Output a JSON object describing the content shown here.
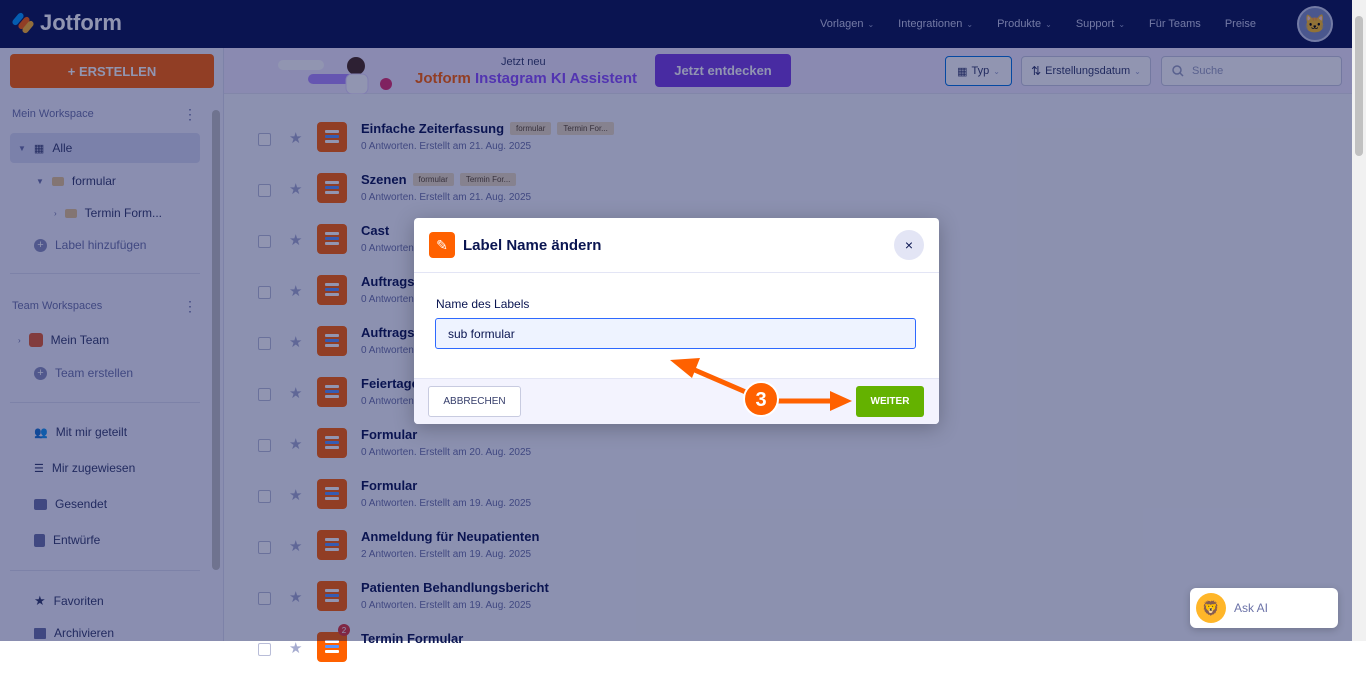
{
  "brand": {
    "name": "Jotform"
  },
  "nav": {
    "items": [
      {
        "label": "Vorlagen",
        "caret": true
      },
      {
        "label": "Integrationen",
        "caret": true
      },
      {
        "label": "Produkte",
        "caret": true
      },
      {
        "label": "Support",
        "caret": true
      },
      {
        "label": "Für Teams",
        "caret": false
      },
      {
        "label": "Preise",
        "caret": false
      }
    ]
  },
  "sidebar": {
    "create_label": "+ ERSTELLEN",
    "my_workspace": "Mein Workspace",
    "all_label": "Alle",
    "folder1": "formular",
    "folder2": "Termin Form...",
    "add_label": "Label hinzufügen",
    "team_workspaces": "Team Workspaces",
    "my_team": "Mein Team",
    "create_team": "Team erstellen",
    "shared": "Mit mir geteilt",
    "assigned": "Mir zugewiesen",
    "sent": "Gesendet",
    "drafts": "Entwürfe",
    "favorites": "Favoriten",
    "archive": "Archivieren"
  },
  "banner": {
    "new_label": "Jetzt neu",
    "title_a": "Jotform",
    "title_b": "Instagram KI Assistent",
    "cta": "Jetzt entdecken"
  },
  "toolbar": {
    "type_label": "Typ",
    "sort_label": "Erstellungsdatum",
    "search_placeholder": "Suche"
  },
  "forms": [
    {
      "title": "Einfache Zeiterfassung",
      "tags": [
        "formular",
        "Termin For..."
      ],
      "meta": "0 Antworten. Erstellt am 21. Aug. 2025"
    },
    {
      "title": "Szenen",
      "tags": [
        "formular",
        "Termin For..."
      ],
      "meta": "0 Antworten. Erstellt am 21. Aug. 2025"
    },
    {
      "title": "Cast",
      "tags": [],
      "meta": "0 Antworten"
    },
    {
      "title": "Auftrags",
      "tags": [],
      "meta": "0 Antworten"
    },
    {
      "title": "Auftrags",
      "tags": [],
      "meta": "0 Antworten"
    },
    {
      "title": "Feiertage",
      "tags": [],
      "meta": "0 Antworten"
    },
    {
      "title": "Formular",
      "tags": [],
      "meta": "0 Antworten. Erstellt am 20. Aug. 2025"
    },
    {
      "title": "Formular",
      "tags": [],
      "meta": "0 Antworten. Erstellt am 19. Aug. 2025"
    },
    {
      "title": "Anmeldung für Neupatienten",
      "tags": [],
      "meta": "2 Antworten. Erstellt am 19. Aug. 2025"
    },
    {
      "title": "Patienten Behandlungsbericht",
      "tags": [],
      "meta": "0 Antworten. Erstellt am 19. Aug. 2025"
    },
    {
      "title": "Termin Formular",
      "tags": [],
      "meta": "",
      "badge": "2"
    }
  ],
  "modal": {
    "title": "Label Name ändern",
    "field_label": "Name des Labels",
    "field_value": "sub formular",
    "cancel": "ABBRECHEN",
    "next": "WEITER",
    "close": "×"
  },
  "annotation": {
    "step": "3"
  },
  "ask_ai": {
    "label": "Ask AI"
  },
  "colors": {
    "nav_bg": "#0a1551",
    "accent": "#ff6100",
    "next_green": "#64b200",
    "purple": "#7b3fe4"
  }
}
